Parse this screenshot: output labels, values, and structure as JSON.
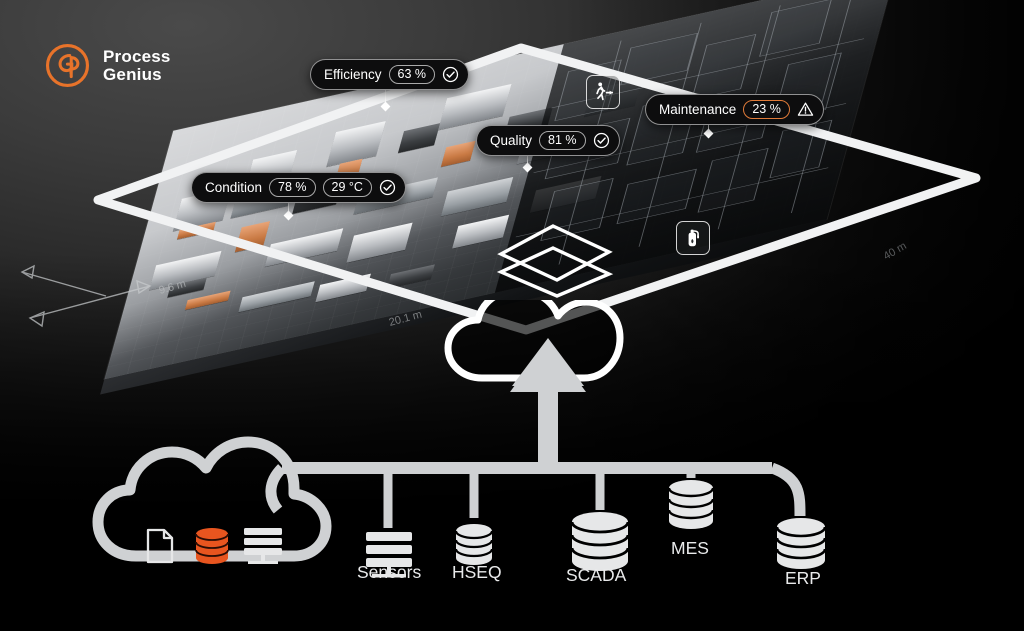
{
  "brand": {
    "name_line1": "Process",
    "name_line2": "Genius",
    "logo_icon": "gp-monogram-icon",
    "accent_color": "#E8732A"
  },
  "scene": {
    "title": "factory-digital-twin-isometric-view",
    "dimension_labels": [
      {
        "name": "width-dimension",
        "text": "9.6 m"
      },
      {
        "name": "length-dimension",
        "text": "20.1 m"
      },
      {
        "name": "depth-dimension",
        "text": "40 m"
      }
    ],
    "layer_indicator": "stacked-layers-diamonds"
  },
  "kpi_badges": [
    {
      "id": "efficiency",
      "label": "Efficiency",
      "values": [
        {
          "text": "63 %",
          "state": "ok"
        }
      ],
      "status_icon": "check-circle-icon",
      "status": "ok"
    },
    {
      "id": "maintenance",
      "label": "Maintenance",
      "values": [
        {
          "text": "23 %",
          "state": "warn"
        }
      ],
      "status_icon": "warning-triangle-icon",
      "status": "warn"
    },
    {
      "id": "quality",
      "label": "Quality",
      "values": [
        {
          "text": "81 %",
          "state": "ok"
        }
      ],
      "status_icon": "check-circle-icon",
      "status": "ok"
    },
    {
      "id": "condition",
      "label": "Condition",
      "values": [
        {
          "text": "78 %",
          "state": "ok"
        },
        {
          "text": "29 °C",
          "state": "ok"
        }
      ],
      "status_icon": "check-circle-icon",
      "status": "ok"
    }
  ],
  "safety_markers": [
    {
      "id": "emergency-exit",
      "icon": "running-person-exit-icon"
    },
    {
      "id": "fire-extinguisher",
      "icon": "fire-extinguisher-icon"
    }
  ],
  "dataflow": {
    "upload_cloud": {
      "icon": "cloud-upload-arrow-icon",
      "name": "cloud-upload"
    },
    "source_cloud": {
      "name": "data-sources-cloud",
      "icons": [
        {
          "id": "file",
          "icon": "document-file-icon",
          "color": "#ffffff"
        },
        {
          "id": "database",
          "icon": "database-cylinder-icon",
          "color": "#E8551F"
        },
        {
          "id": "server",
          "icon": "server-rack-icon",
          "color": "#ffffff"
        }
      ]
    },
    "nodes": [
      {
        "id": "sensors",
        "label": "Sensors",
        "icon": "server-rack-icon"
      },
      {
        "id": "hseq",
        "label": "HSEQ",
        "icon": "database-cylinder-icon"
      },
      {
        "id": "scada",
        "label": "SCADA",
        "icon": "database-cylinder-icon"
      },
      {
        "id": "mes",
        "label": "MES",
        "icon": "database-cylinder-icon"
      },
      {
        "id": "erp",
        "label": "ERP",
        "icon": "database-cylinder-icon"
      }
    ]
  },
  "colors": {
    "background_top": "#3b3b3b",
    "background_bottom": "#000000",
    "line": "#d7d9da",
    "accent": "#E8732A",
    "badge_bg": "#0d0d0e"
  }
}
